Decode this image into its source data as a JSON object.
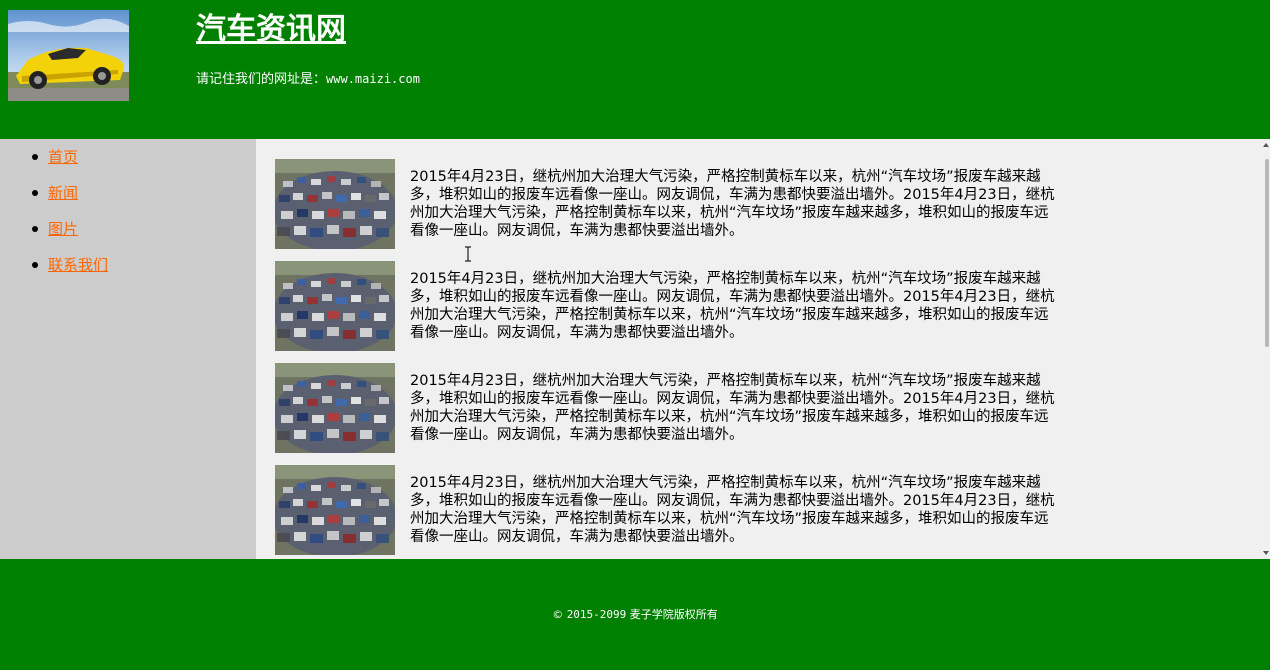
{
  "header": {
    "logo_icon": "sports-car-photo",
    "title": "汽车资讯网",
    "url_label": "请记住我们的网址是：",
    "url": "www.maizi.com"
  },
  "nav": {
    "items": [
      {
        "label": "首页"
      },
      {
        "label": "新闻"
      },
      {
        "label": "图片"
      },
      {
        "label": "联系我们"
      }
    ]
  },
  "news": {
    "thumb_icon": "scrapped-cars-photo",
    "items": [
      {
        "text": "2015年4月23日，继杭州加大治理大气污染，严格控制黄标车以来，杭州“汽车坟场”报废车越来越多，堆积如山的报废车远看像一座山。网友调侃，车满为患都快要溢出墙外。2015年4月23日，继杭州加大治理大气污染，严格控制黄标车以来，杭州“汽车坟场”报废车越来越多，堆积如山的报废车远看像一座山。网友调侃，车满为患都快要溢出墙外。"
      },
      {
        "text": "2015年4月23日，继杭州加大治理大气污染，严格控制黄标车以来，杭州“汽车坟场”报废车越来越多，堆积如山的报废车远看像一座山。网友调侃，车满为患都快要溢出墙外。2015年4月23日，继杭州加大治理大气污染，严格控制黄标车以来，杭州“汽车坟场”报废车越来越多，堆积如山的报废车远看像一座山。网友调侃，车满为患都快要溢出墙外。"
      },
      {
        "text": "2015年4月23日，继杭州加大治理大气污染，严格控制黄标车以来，杭州“汽车坟场”报废车越来越多，堆积如山的报废车远看像一座山。网友调侃，车满为患都快要溢出墙外。2015年4月23日，继杭州加大治理大气污染，严格控制黄标车以来，杭州“汽车坟场”报废车越来越多，堆积如山的报废车远看像一座山。网友调侃，车满为患都快要溢出墙外。"
      },
      {
        "text": "2015年4月23日，继杭州加大治理大气污染，严格控制黄标车以来，杭州“汽车坟场”报废车越来越多，堆积如山的报废车远看像一座山。网友调侃，车满为患都快要溢出墙外。2015年4月23日，继杭州加大治理大气污染，严格控制黄标车以来，杭州“汽车坟场”报废车越来越多，堆积如山的报废车远看像一座山。网友调侃，车满为患都快要溢出墙外。"
      }
    ]
  },
  "footer": {
    "copyright_symbol": "©",
    "years": "2015-2099",
    "owner": "麦子学院版权所有"
  },
  "colors": {
    "header_bg": "#008000",
    "footer_bg": "#008000",
    "sidebar_bg": "#cccccc",
    "main_bg": "#f0f0f0",
    "link": "#ff6600"
  }
}
